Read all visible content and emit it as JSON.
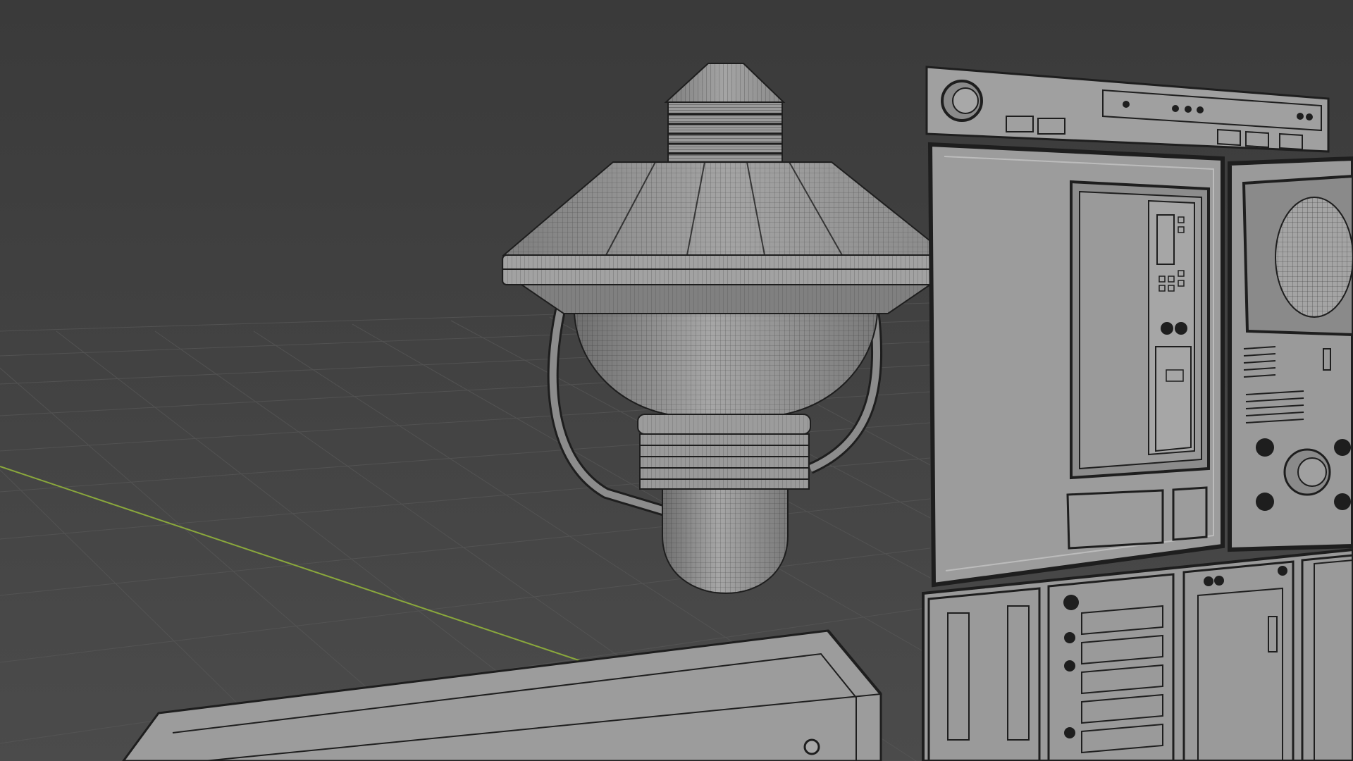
{
  "app": {
    "view": "3D Viewport",
    "shading": "solid-wireframe-overlay"
  },
  "colors": {
    "background_top": "#3a3a3a",
    "background_bottom": "#4a4a4a",
    "grid_line": "#555555",
    "x_axis": "#8aa83c",
    "mesh_fill": "#8f8f8f",
    "mesh_fill_light": "#a8a8a8",
    "mesh_fill_dark": "#6e6e6e",
    "wire": "#1c1c1c"
  },
  "objects": [
    {
      "name": "hanging-lamp-mesh"
    },
    {
      "name": "control-panel-mesh"
    },
    {
      "name": "console-base-mesh"
    }
  ]
}
